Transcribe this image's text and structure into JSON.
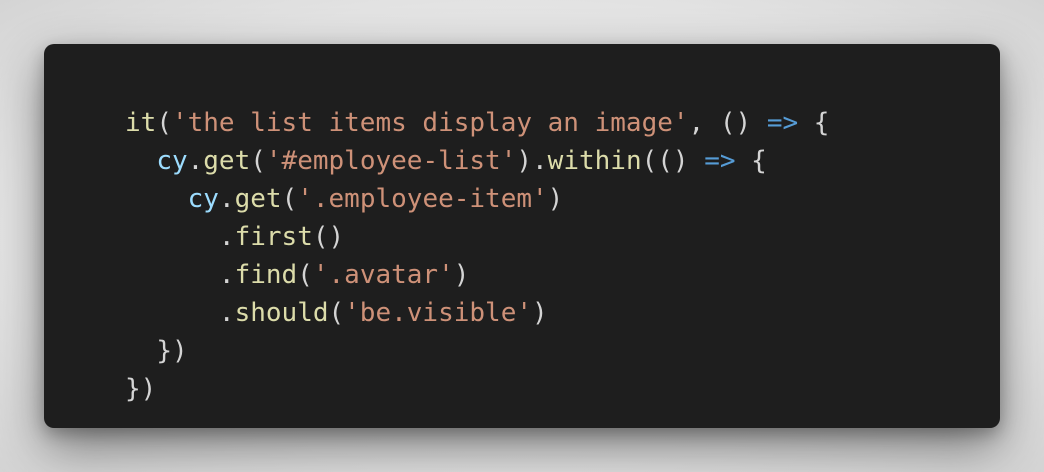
{
  "code": {
    "lines": [
      {
        "indent": "",
        "tokens": [
          {
            "t": "fn",
            "v": "it"
          },
          {
            "t": "pun",
            "v": "("
          },
          {
            "t": "str",
            "v": "'the list items display an image'"
          },
          {
            "t": "pun",
            "v": ", () "
          },
          {
            "t": "kw",
            "v": "=>"
          },
          {
            "t": "pun",
            "v": " {"
          }
        ]
      },
      {
        "indent": "  ",
        "tokens": [
          {
            "t": "var",
            "v": "cy"
          },
          {
            "t": "pun",
            "v": "."
          },
          {
            "t": "fn",
            "v": "get"
          },
          {
            "t": "pun",
            "v": "("
          },
          {
            "t": "str",
            "v": "'#employee-list'"
          },
          {
            "t": "pun",
            "v": ")."
          },
          {
            "t": "fn",
            "v": "within"
          },
          {
            "t": "pun",
            "v": "(() "
          },
          {
            "t": "kw",
            "v": "=>"
          },
          {
            "t": "pun",
            "v": " {"
          }
        ]
      },
      {
        "indent": "    ",
        "tokens": [
          {
            "t": "var",
            "v": "cy"
          },
          {
            "t": "pun",
            "v": "."
          },
          {
            "t": "fn",
            "v": "get"
          },
          {
            "t": "pun",
            "v": "("
          },
          {
            "t": "str",
            "v": "'.employee-item'"
          },
          {
            "t": "pun",
            "v": ")"
          }
        ]
      },
      {
        "indent": "      ",
        "tokens": [
          {
            "t": "pun",
            "v": "."
          },
          {
            "t": "fn",
            "v": "first"
          },
          {
            "t": "pun",
            "v": "()"
          }
        ]
      },
      {
        "indent": "      ",
        "tokens": [
          {
            "t": "pun",
            "v": "."
          },
          {
            "t": "fn",
            "v": "find"
          },
          {
            "t": "pun",
            "v": "("
          },
          {
            "t": "str",
            "v": "'.avatar'"
          },
          {
            "t": "pun",
            "v": ")"
          }
        ]
      },
      {
        "indent": "      ",
        "tokens": [
          {
            "t": "pun",
            "v": "."
          },
          {
            "t": "fn",
            "v": "should"
          },
          {
            "t": "pun",
            "v": "("
          },
          {
            "t": "str",
            "v": "'be.visible'"
          },
          {
            "t": "pun",
            "v": ")"
          }
        ]
      },
      {
        "indent": "  ",
        "tokens": [
          {
            "t": "pun",
            "v": "})"
          }
        ]
      },
      {
        "indent": "",
        "tokens": [
          {
            "t": "pun",
            "v": "})"
          }
        ]
      }
    ]
  },
  "theme": {
    "background": "#1e1e1e",
    "default": "#d4d4d4",
    "function": "#dcdcaa",
    "string": "#ce9178",
    "keyword": "#569cd6",
    "variable": "#9cdcfe"
  }
}
